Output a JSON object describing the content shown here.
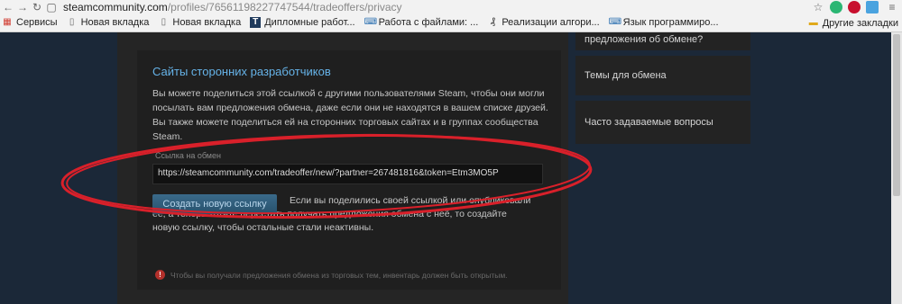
{
  "browser": {
    "url_host": "steamcommunity.com",
    "url_path": "/profiles/76561198227747544/tradeoffers/privacy",
    "bookmarks": [
      {
        "label": "Сервисы",
        "icon": "apps-grid-icon"
      },
      {
        "label": "Новая вкладка",
        "icon": "page-icon"
      },
      {
        "label": "Новая вкладка",
        "icon": "page-icon"
      },
      {
        "label": "Дипломные работ...",
        "icon": "t-icon"
      },
      {
        "label": "Работа с файлами: ...",
        "icon": "code-icon"
      },
      {
        "label": "Реализации алгори...",
        "icon": "algo-icon"
      },
      {
        "label": "Язык программиро...",
        "icon": "code-icon"
      }
    ],
    "other_bookmarks": "Другие закладки"
  },
  "sidebar": {
    "items": [
      {
        "label": "предложения об обмене?"
      },
      {
        "label": "Темы для обмена"
      },
      {
        "label": "Часто задаваемые вопросы"
      }
    ]
  },
  "main": {
    "section_title": "Сайты сторонних разработчиков",
    "description": "Вы можете поделиться этой ссылкой с другими пользователями Steam, чтобы они могли посылать вам предложения обмена, даже если они не находятся в вашем списке друзей. Вы также можете поделиться ей на сторонних торговых сайтах и в группах сообщества Steam.",
    "link_label": "Ссылка на обмен",
    "trade_link": "https://steamcommunity.com/tradeoffer/new/?partner=267481816&token=Etm3MO5P",
    "new_link_button": "Создать новую ссылку",
    "new_link_description": "Если вы поделились своей ссылкой или опубликовали ее, а теперь хотите перестать получать предложения обмена с неё, то создайте новую ссылку, чтобы остальные стали неактивны.",
    "warning": "Чтобы вы получали предложения обмена из торговых тем, инвентарь должен быть открытым."
  },
  "colors": {
    "accent": "#66b3e8",
    "annotation": "#d9202a",
    "page_bg": "#1b2838"
  }
}
